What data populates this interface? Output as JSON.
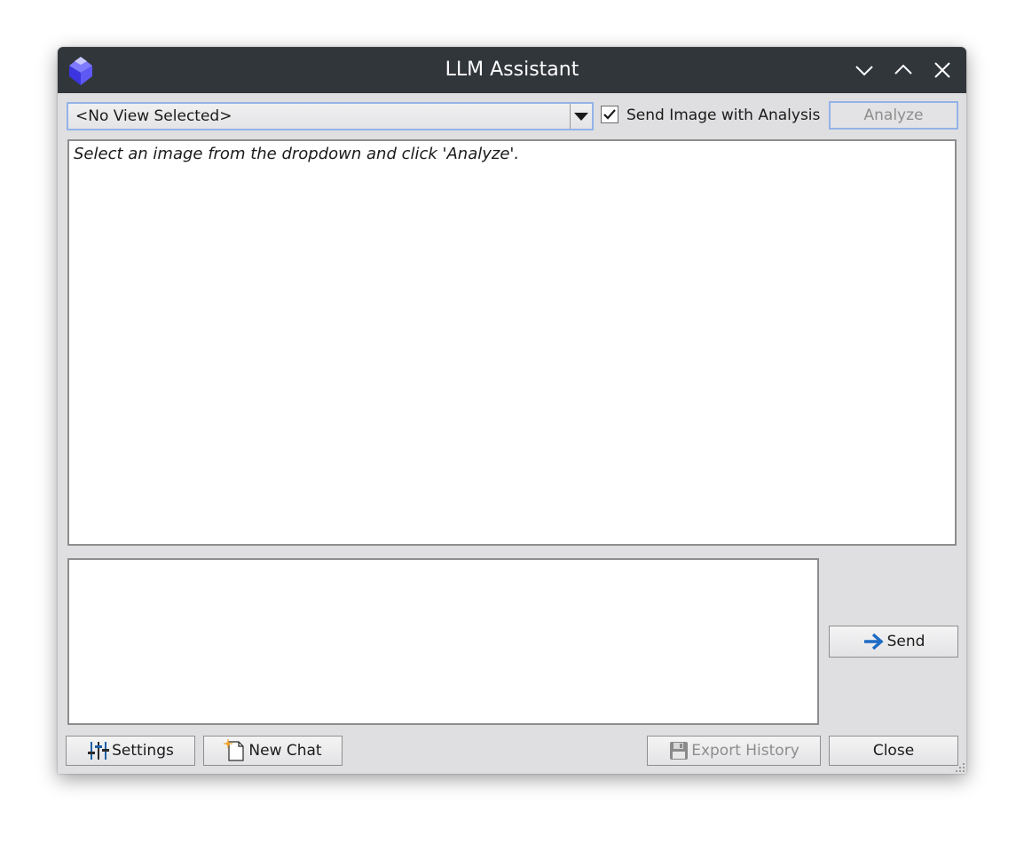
{
  "window": {
    "title": "LLM Assistant"
  },
  "titlebar": {
    "buttons": {
      "minimize": "chevron-down-icon",
      "maximize": "chevron-up-icon",
      "close": "close-icon"
    },
    "bg_color": "#31363b"
  },
  "toolbar": {
    "view_select": {
      "value": "<No View Selected>"
    },
    "send_image_checkbox": {
      "label": "Send Image with Analysis",
      "checked": true
    },
    "analyze_label": "Analyze"
  },
  "output": {
    "text": "Select an image from the dropdown and click 'Analyze'."
  },
  "input": {
    "value": ""
  },
  "buttons": {
    "send_label": "Send",
    "settings_label": "Settings",
    "new_chat_label": "New Chat",
    "export_history_label": "Export History",
    "close_label": "Close"
  },
  "colors": {
    "accent": "#93b3e8",
    "send_arrow": "#1d6bc4"
  }
}
